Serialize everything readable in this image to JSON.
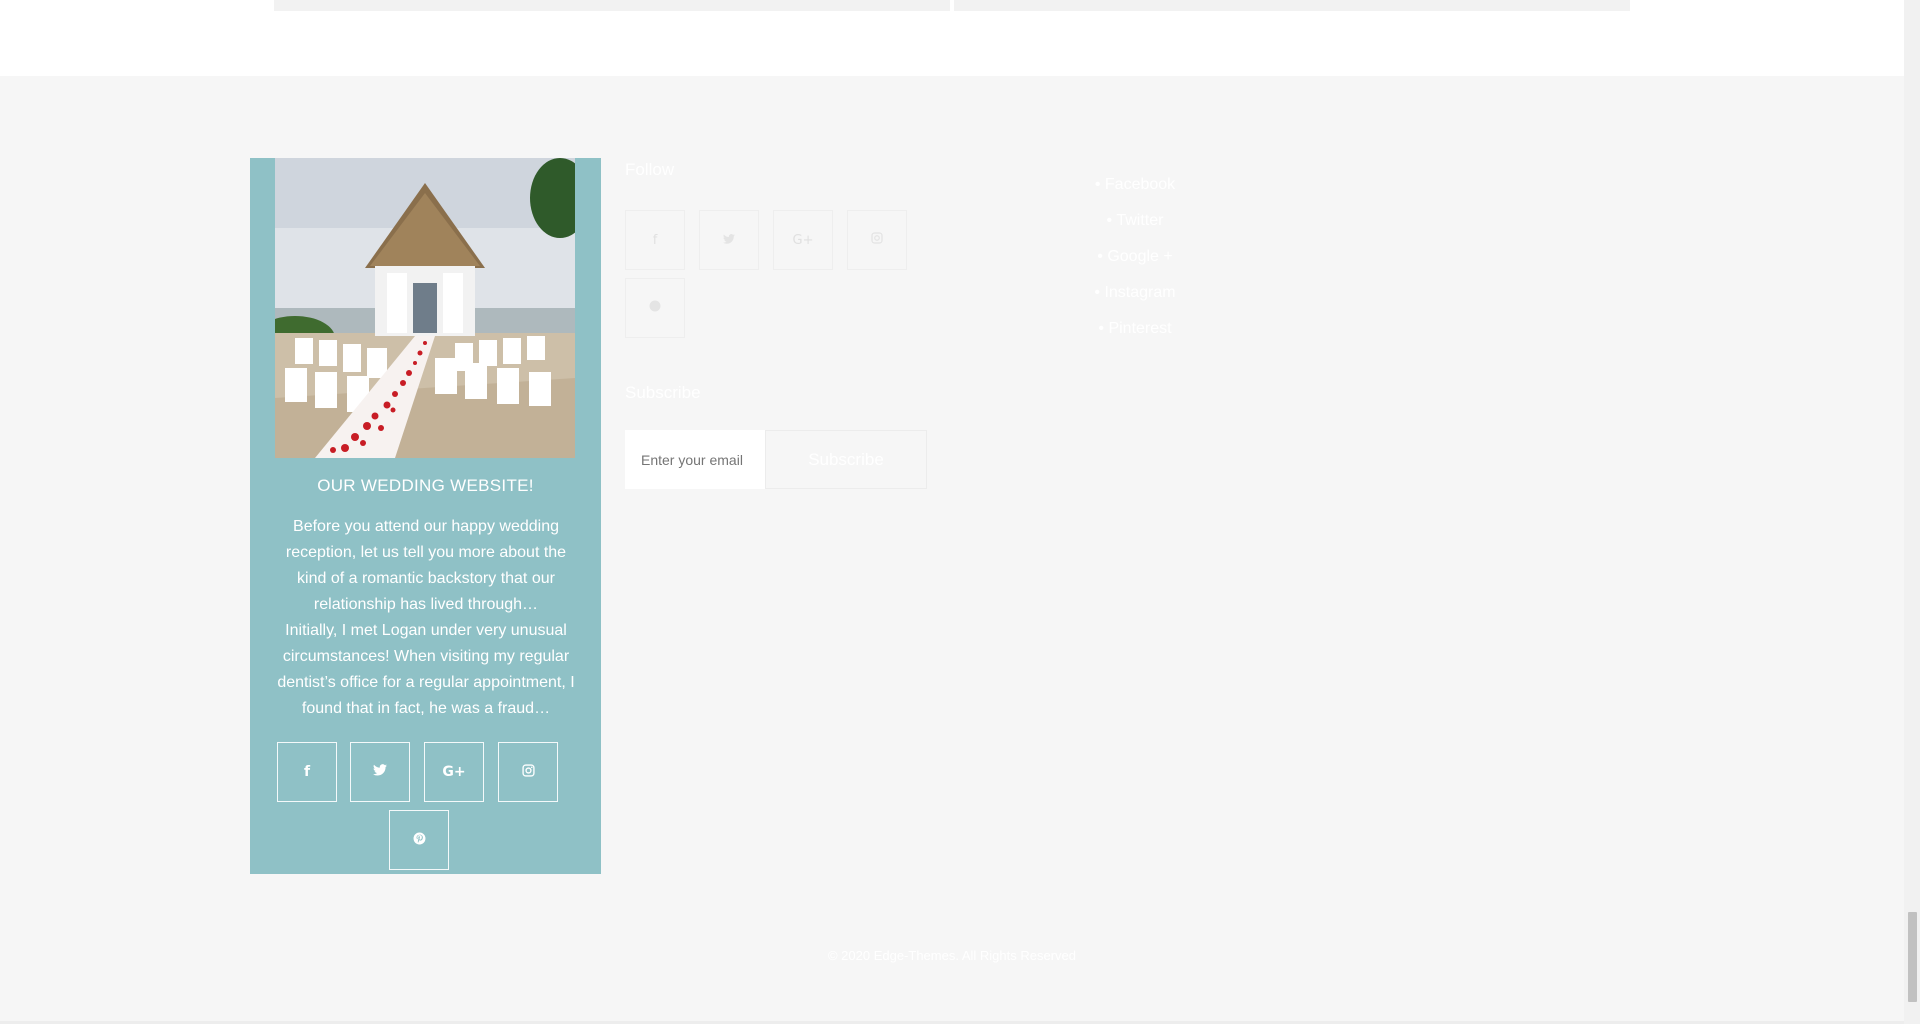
{
  "about": {
    "title": "OUR WEDDING WEBSITE!",
    "paragraph1": "Before you attend our happy wedding reception, let us tell you more about the kind of a romantic backstory that our relationship has lived through…",
    "paragraph2": "Initially, I met Logan under very unusual circumstances! When visiting my regular dentist’s office for a regular appointment, I found that in fact, he was a fraud…",
    "social": [
      {
        "icon": "facebook-icon",
        "glyph": "f"
      },
      {
        "icon": "twitter-icon",
        "glyph": "🐦"
      },
      {
        "icon": "google-plus-icon",
        "glyph": "G+"
      },
      {
        "icon": "instagram-icon",
        "glyph": "◎"
      },
      {
        "icon": "pinterest-icon",
        "glyph": "℗"
      }
    ]
  },
  "follow": {
    "title": "Follow",
    "social": [
      {
        "icon": "facebook-icon",
        "glyph": "f"
      },
      {
        "icon": "twitter-icon",
        "glyph": "🐦"
      },
      {
        "icon": "google-plus-icon",
        "glyph": "G+"
      },
      {
        "icon": "instagram-icon",
        "glyph": "◎"
      },
      {
        "icon": "pinterest-icon",
        "glyph": "℗"
      }
    ],
    "links": [
      "Facebook",
      "Twitter",
      "Google +",
      "Instagram",
      "Pinterest"
    ]
  },
  "subscribe": {
    "title": "Subscribe",
    "placeholder": "Enter your email",
    "button": "Subscribe"
  },
  "copyright": "© 2020 Edge-Themes. All Rights Reserved",
  "colors": {
    "about_bg": "#8fc1c6",
    "footer_bg": "#f6f6f6"
  }
}
